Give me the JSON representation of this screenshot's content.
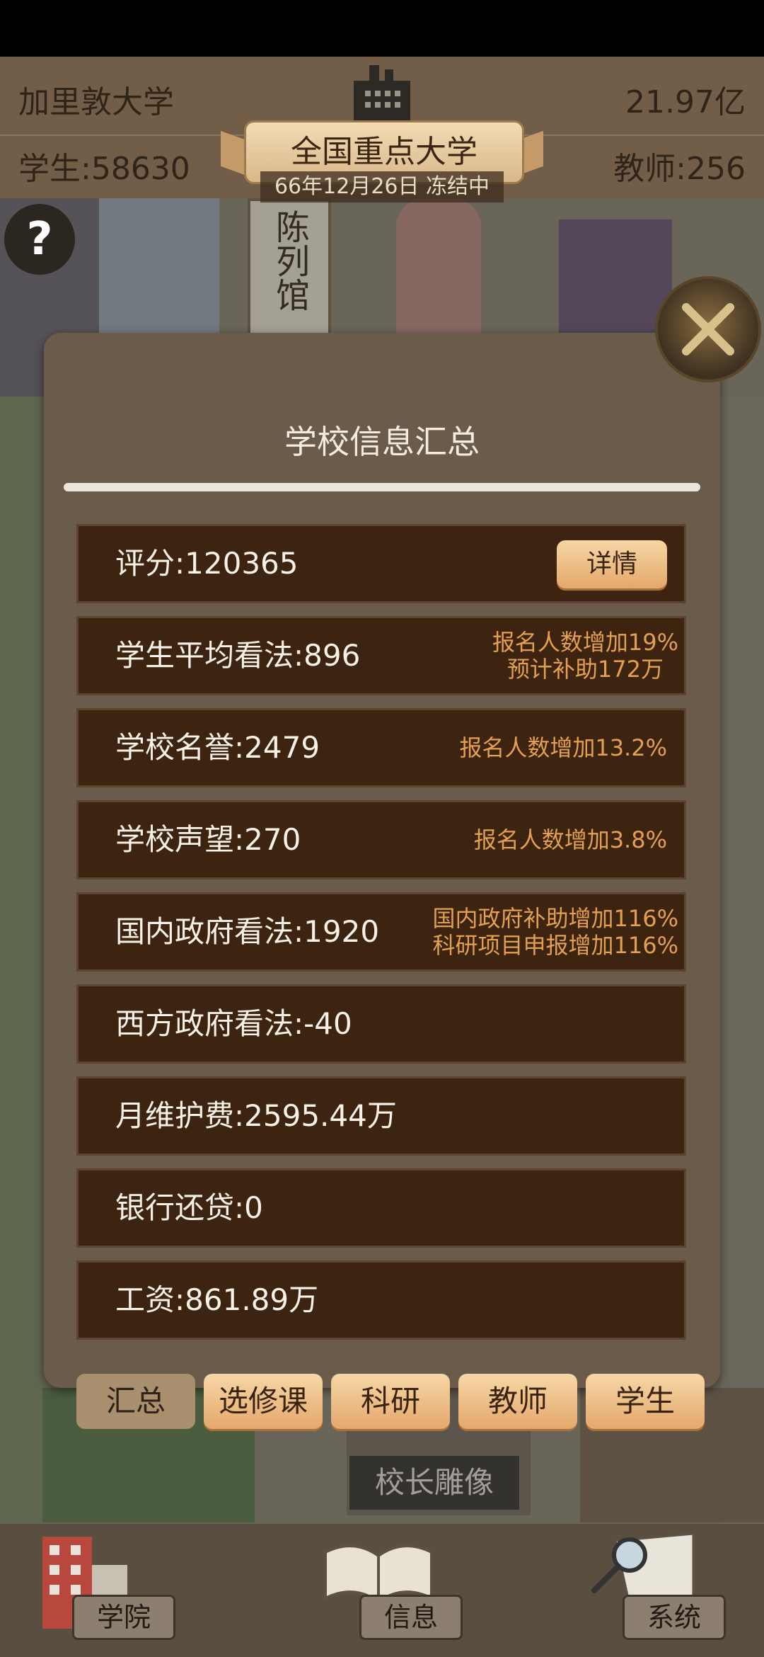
{
  "hud": {
    "school_name": "加里敦大学",
    "money": "21.97亿",
    "students": "学生:58630",
    "teachers": "教师:256",
    "rank": "全国重点大学",
    "date_status": "66年12月26日 冻结中"
  },
  "scene_labels": {
    "exhibition_hall": "陈列馆",
    "statue": "校长雕像",
    "help": "?"
  },
  "dialog": {
    "title": "学校信息汇总",
    "detail_button": "详情",
    "rows": [
      {
        "label": "评分:120365"
      },
      {
        "label": "学生平均看法:896",
        "note1": "报名人数增加19%",
        "note2": "预计补助172万"
      },
      {
        "label": "学校名誉:2479",
        "note1": "报名人数增加13.2%"
      },
      {
        "label": "学校声望:270",
        "note1": "报名人数增加3.8%"
      },
      {
        "label": "国内政府看法:1920",
        "note1": "国内政府补助增加116%",
        "note2": "科研项目申报增加116%"
      },
      {
        "label": "西方政府看法:-40"
      },
      {
        "label": "月维护费:2595.44万"
      },
      {
        "label": "银行还贷:0"
      },
      {
        "label": "工资:861.89万"
      }
    ],
    "tabs": [
      "汇总",
      "选修课",
      "科研",
      "教师",
      "学生"
    ],
    "active_tab": "汇总"
  },
  "bottom_nav": {
    "college": "学院",
    "info": "信息",
    "system": "系统"
  },
  "icons": {
    "close": "close-x-icon",
    "help": "question-icon",
    "college": "building-icon",
    "info": "open-book-icon",
    "system": "magnifier-paper-icon"
  },
  "colors": {
    "row_bg": "#3d2410",
    "note_text": "#e39f52",
    "dialog_bg": "#6a5b4a",
    "button_gold": "#e4a86a"
  }
}
